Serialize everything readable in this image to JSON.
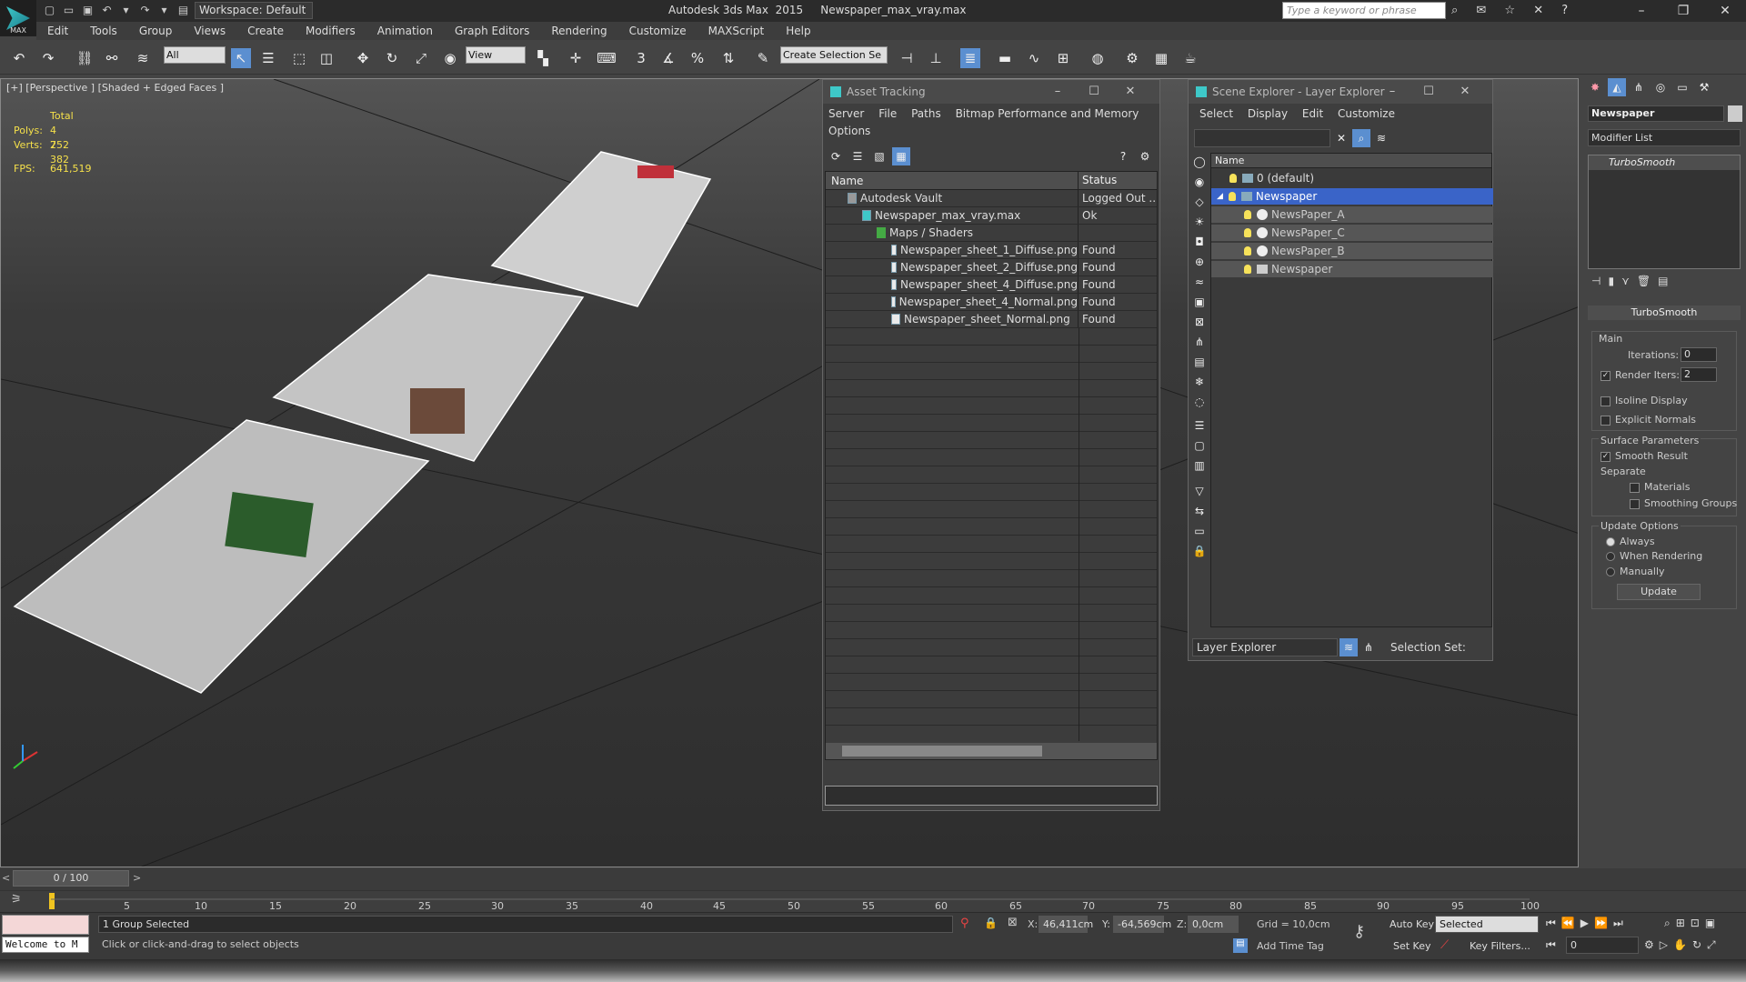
{
  "app": {
    "logo_text": "MAX",
    "workspace": "Workspace: Default",
    "title": "Autodesk 3ds Max  2015     Newspaper_max_vray.max",
    "search_placeholder": "Type a keyword or phrase"
  },
  "menu": [
    "Edit",
    "Tools",
    "Group",
    "Views",
    "Create",
    "Modifiers",
    "Animation",
    "Graph Editors",
    "Rendering",
    "Customize",
    "MAXScript",
    "Help"
  ],
  "toolbar": {
    "filter_value": "All",
    "ref_coord": "View",
    "selection_set": "Create Selection Se"
  },
  "viewport": {
    "label": "[+] [Perspective ] [Shaded + Edged Faces ]",
    "stats_header": "Total",
    "polys_label": "Polys:",
    "polys_value": "4 752",
    "verts_label": "Verts:",
    "verts_value": "2 382",
    "fps_label": "FPS:",
    "fps_value": "641,519",
    "axis_x": "x",
    "axis_y": "y",
    "axis_z": "z"
  },
  "asset_tracking": {
    "title": "Asset Tracking",
    "menu": [
      "Server",
      "File",
      "Paths",
      "Bitmap Performance and Memory"
    ],
    "menu2": "Options",
    "col_name": "Name",
    "col_status": "Status",
    "rows": [
      {
        "name": "Autodesk Vault",
        "status": "Logged Out ..."
      },
      {
        "name": "Newspaper_max_vray.max",
        "status": "Ok"
      },
      {
        "name": "Maps / Shaders",
        "status": ""
      },
      {
        "name": "Newspaper_sheet_1_Diffuse.png",
        "status": "Found"
      },
      {
        "name": "Newspaper_sheet_2_Diffuse.png",
        "status": "Found"
      },
      {
        "name": "Newspaper_sheet_4_Diffuse.png",
        "status": "Found"
      },
      {
        "name": "Newspaper_sheet_4_Normal.png",
        "status": "Found"
      },
      {
        "name": "Newspaper_sheet_Normal.png",
        "status": "Found"
      }
    ]
  },
  "scene_explorer": {
    "title": "Scene Explorer - Layer Explorer",
    "menu": [
      "Select",
      "Display",
      "Edit",
      "Customize"
    ],
    "col_name": "Name",
    "rows": [
      {
        "name": "0 (default)"
      },
      {
        "name": "Newspaper"
      },
      {
        "name": "NewsPaper_A"
      },
      {
        "name": "NewsPaper_C"
      },
      {
        "name": "NewsPaper_B"
      },
      {
        "name": "Newspaper"
      }
    ],
    "explorer_select": "Layer Explorer",
    "selection_set": "Selection Set:"
  },
  "command_panel": {
    "object_name": "Newspaper",
    "modifier_list": "Modifier List",
    "stack_item": "TurboSmooth",
    "rollout_title": "TurboSmooth",
    "main": "Main",
    "iterations_label": "Iterations:",
    "iterations_value": "0",
    "render_iters_label": "Render Iters:",
    "render_iters_value": "2",
    "isoline": "Isoline Display",
    "explicit_normals": "Explicit Normals",
    "surface_params": "Surface Parameters",
    "smooth_result": "Smooth Result",
    "separate": "Separate",
    "materials": "Materials",
    "smoothing_groups": "Smoothing Groups",
    "update_options": "Update Options",
    "always": "Always",
    "when_rendering": "When Rendering",
    "manually": "Manually",
    "update_btn": "Update"
  },
  "timeline": {
    "frame": "0 / 100",
    "ticks": [
      "5",
      "10",
      "15",
      "20",
      "25",
      "30",
      "35",
      "40",
      "45",
      "50",
      "55",
      "60",
      "65",
      "70",
      "75",
      "80",
      "85",
      "90",
      "95",
      "100"
    ]
  },
  "status": {
    "maxscript": "Welcome to M",
    "selected": "1 Group Selected",
    "prompt": "Click or click-and-drag to select objects",
    "x_label": "X:",
    "x_value": "46,411cm",
    "y_label": "Y:",
    "y_value": "-64,569cm",
    "z_label": "Z:",
    "z_value": "0,0cm",
    "grid": "Grid = 10,0cm",
    "add_time_tag": "Add Time Tag",
    "auto_key": "Auto Key",
    "set_key": "Set Key",
    "key_mode": "Selected",
    "key_filters": "Key Filters...",
    "frame_value": "0"
  }
}
